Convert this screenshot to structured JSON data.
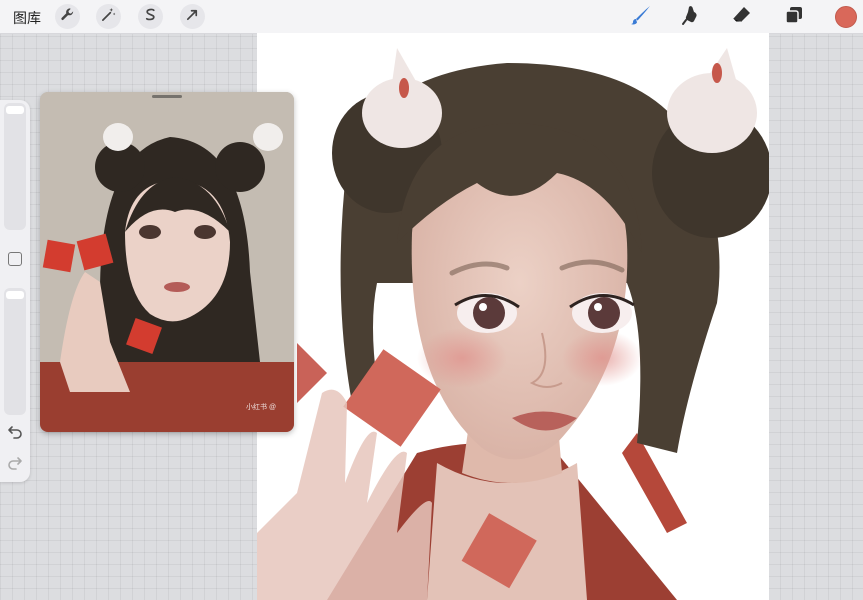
{
  "topbar": {
    "gallery_label": "图库",
    "left_tools": [
      {
        "name": "wrench-icon"
      },
      {
        "name": "magic-wand-icon"
      },
      {
        "name": "selection-icon"
      },
      {
        "name": "transform-arrow-icon"
      }
    ],
    "right_tools": [
      {
        "name": "brush-icon",
        "active_color": "#3a7bd5"
      },
      {
        "name": "smudge-icon"
      },
      {
        "name": "eraser-icon"
      },
      {
        "name": "layers-icon"
      }
    ],
    "current_color": "#d9685a"
  },
  "sidebar": {
    "icons": [
      "square-modifier-icon",
      "undo-icon",
      "redo-icon"
    ]
  },
  "reference": {
    "watermark": "小红书 @"
  },
  "colors": {
    "accent_blue": "#3a7bd5",
    "brush_red": "#d9685a"
  }
}
